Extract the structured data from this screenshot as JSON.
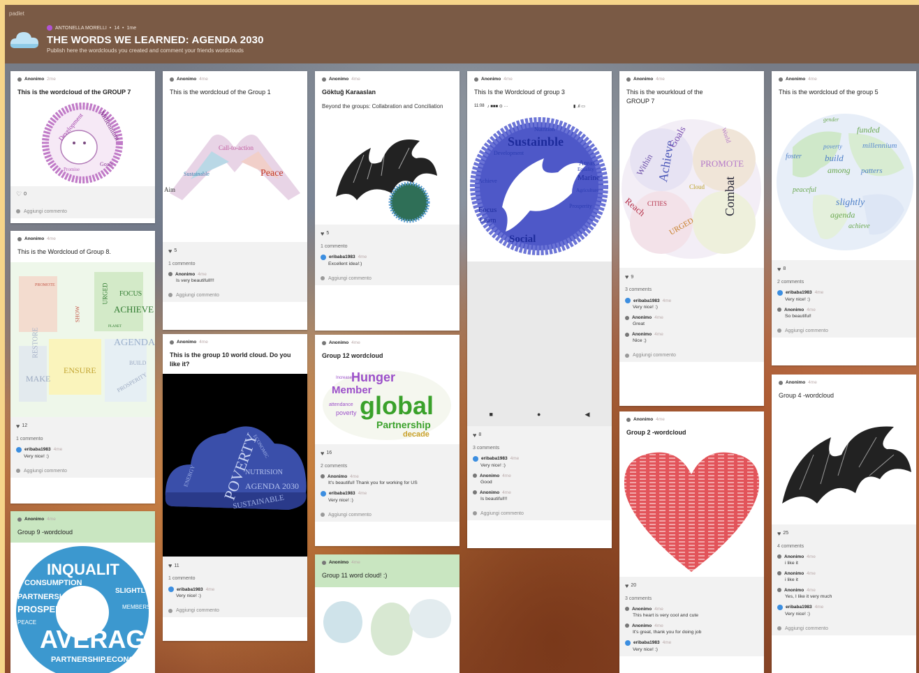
{
  "brand": "padlet",
  "header": {
    "author": "ANTONELLA MORELLI",
    "dot1": "•",
    "count": "14",
    "dot2": "•",
    "time": "1me",
    "title": "THE WORDS WE LEARNED: AGENDA 2030",
    "subtitle": "Publish here the wordclouds you created and comment your friends wordclouds"
  },
  "ui": {
    "add_comment": "Aggiungi commento"
  },
  "posts": [
    {
      "author": "Anonimo",
      "time": "2me",
      "title": "This is the wordcloud of the GROUP 7",
      "likes": "0",
      "words": [
        "Development",
        "Millennium",
        "Promise",
        "Goals"
      ]
    },
    {
      "author": "Anonimo",
      "time": "4me",
      "title": "This is the Wordcloud of Group 8.",
      "likes": "12",
      "comments_count": "1 commento",
      "comments": [
        {
          "author": "eribaba1983",
          "time": "4me",
          "text": "Very nice! :)"
        }
      ],
      "words": [
        "PROMOTE",
        "FOCUS",
        "ACHIEVE",
        "AGENDA",
        "ENSURE",
        "MAKE",
        "RESTORE",
        "URGED",
        "SHOW",
        "BUILD",
        "PROSPERITY",
        "PLANET"
      ]
    },
    {
      "author": "Anonimo",
      "time": "4me",
      "title": "Group 9 -wordcloud",
      "words": [
        "INQUALIT",
        "CONSUMPTION",
        "PARTNERSHIP",
        "PROSPERITY",
        "AVERAGE",
        "SLIGHTLY",
        "PARTNERSHIP.ECONOMY",
        "MEMBERS",
        "PEACE"
      ]
    },
    {
      "author": "Anonimo",
      "time": "4me",
      "title": "This is the wordcloud of the Group 1",
      "likes": "5",
      "comments_count": "1 commento",
      "comments": [
        {
          "author": "Anonimo",
          "time": "4me",
          "text": "Is very beautifull!!!"
        }
      ],
      "words": [
        "Call-to-action",
        "Peace",
        "Aim",
        "Sustainable"
      ]
    },
    {
      "author": "Anonimo",
      "time": "4me",
      "title": "This is the group 10 world cloud.  Do you like it?",
      "likes": "11",
      "comments_count": "1 commento",
      "comments": [
        {
          "author": "eribaba1983",
          "time": "4me",
          "text": "Very nice! :)"
        }
      ],
      "words": [
        "POVERTY",
        "SUSTAINABLE",
        "NUTRISION",
        "AGENDA 2030",
        "ENERGY",
        "ECONOMIC"
      ]
    },
    {
      "author": "Anonimo",
      "time": "4me",
      "title": "Göktuğ Karaaslan",
      "body": "Beyond the groups: Collabration and Conciliation",
      "likes": "5",
      "comments_count": "1 commento",
      "comments": [
        {
          "author": "eribaba1983",
          "time": "4me",
          "text": "Excellent idea!:)"
        }
      ]
    },
    {
      "author": "Anonimo",
      "time": "4me",
      "title": "Group 12 wordcloud",
      "likes": "16",
      "comments_count": "2 comments",
      "comments": [
        {
          "author": "Anonimo",
          "time": "4me",
          "text": "It's beautiful! Thank you for working for US"
        },
        {
          "author": "eribaba1983",
          "time": "4me",
          "text": "Very nice! :)"
        }
      ],
      "words": [
        "Hunger",
        "Member",
        "global",
        "Partnership",
        "decade",
        "poverty",
        "attendance",
        "Increase"
      ]
    },
    {
      "author": "Anonimo",
      "time": "4me",
      "title": "Group 11 word cloud! :)"
    },
    {
      "author": "Anonimo",
      "time": "4me",
      "title": "This Is the Wordcloud of group 3",
      "phone_time": "11:08",
      "likes": "8",
      "comments_count": "3 comments",
      "comments": [
        {
          "author": "eribaba1983",
          "time": "4me",
          "text": "Very nice! :)"
        },
        {
          "author": "Anonimo",
          "time": "4me",
          "text": "Good"
        },
        {
          "author": "Anonimo",
          "time": "4me",
          "text": "Is beautiful!!!"
        }
      ],
      "words": [
        "Sustainble",
        "Nutrition",
        "Development",
        "Areas",
        "Marine",
        "Focus",
        "Learn",
        "Social",
        "Prosperity",
        "Equality",
        "Achieve",
        "Agriculture"
      ]
    },
    {
      "author": "Anonimo",
      "time": "4me",
      "title": "This is the wourkloud of the GROUP 7",
      "likes": "9",
      "comments_count": "3 comments",
      "comments": [
        {
          "author": "eribaba1983",
          "time": "4me",
          "text": "Very nice! :)"
        },
        {
          "author": "Anonimo",
          "time": "4me",
          "text": "Great"
        },
        {
          "author": "Anonimo",
          "time": "4me",
          "text": "Nice ;)"
        }
      ],
      "words": [
        "Achieve",
        "Within",
        "Goals",
        "PROMOTE",
        "Combat",
        "Reach",
        "CITIES",
        "URGED",
        "Cloud",
        "World"
      ]
    },
    {
      "author": "Anonimo",
      "time": "4me",
      "title": "Group 2 -wordcloud",
      "likes": "20",
      "comments_count": "3 comments",
      "comments": [
        {
          "author": "Anonimo",
          "time": "4me",
          "text": "This heart is very cool and cute"
        },
        {
          "author": "Anonimo",
          "time": "4me",
          "text": "It's great, thank you for doing job"
        },
        {
          "author": "eribaba1983",
          "time": "4me",
          "text": "Very nice! :)"
        }
      ]
    },
    {
      "author": "Anonimo",
      "time": "4me",
      "title": "This is the wordcloud of the group 5",
      "likes": "8",
      "comments_count": "2 comments",
      "comments": [
        {
          "author": "eribaba1983",
          "time": "4me",
          "text": "Very nice! :)"
        },
        {
          "author": "Anonimo",
          "time": "4me",
          "text": "So beautiful!"
        }
      ],
      "words": [
        "funded",
        "millennium",
        "poverty",
        "build",
        "among",
        "patters",
        "foster",
        "peaceful",
        "slightly",
        "agenda",
        "achieve",
        "gender"
      ]
    },
    {
      "author": "Anonimo",
      "time": "4me",
      "title": "Group 4 -wordcloud",
      "likes": "25",
      "comments_count": "4 comments",
      "comments": [
        {
          "author": "Anonimo",
          "time": "4me",
          "text": "i like it"
        },
        {
          "author": "Anonimo",
          "time": "4me",
          "text": "i like it"
        },
        {
          "author": "Anonimo",
          "time": "4me",
          "text": "Yes, I like it very much"
        },
        {
          "author": "eribaba1983",
          "time": "4me",
          "text": "Very nice! :)"
        }
      ]
    }
  ]
}
